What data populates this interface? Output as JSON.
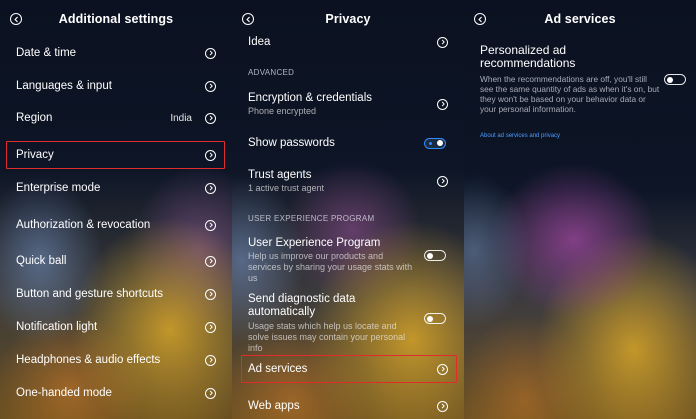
{
  "panel1": {
    "title": "Additional settings",
    "items": [
      {
        "label": "Date & time"
      },
      {
        "label": "Languages & input"
      },
      {
        "label": "Region",
        "value": "India"
      },
      {
        "label": "Privacy"
      },
      {
        "label": "Enterprise mode"
      },
      {
        "label": "Authorization & revocation"
      },
      {
        "label": "Quick ball"
      },
      {
        "label": "Button and gesture shortcuts"
      },
      {
        "label": "Notification light"
      },
      {
        "label": "Headphones & audio effects"
      },
      {
        "label": "One-handed mode"
      }
    ]
  },
  "panel2": {
    "title": "Privacy",
    "idea": "Idea",
    "section_advanced": "ADVANCED",
    "encryption": {
      "label": "Encryption & credentials",
      "sub": "Phone encrypted"
    },
    "show_passwords": {
      "label": "Show passwords",
      "enabled": true
    },
    "trust_agents": {
      "label": "Trust agents",
      "sub": "1 active trust agent"
    },
    "section_uep": "USER EXPERIENCE PROGRAM",
    "uep": {
      "label": "User Experience Program",
      "sub": "Help us improve our products and services by sharing your usage stats with us",
      "enabled": false
    },
    "diagnostic": {
      "label": "Send diagnostic data automatically",
      "sub": "Usage stats which help us locate and solve issues may contain your personal info",
      "enabled": false
    },
    "ad_services": "Ad services",
    "web_apps": "Web apps"
  },
  "panel3": {
    "title": "Ad services",
    "personalized_title": "Personalized ad recommendations",
    "personalized_desc": "When the recommendations are off, you'll still see the same quantity of ads as when it's on, but they won't be based on your behavior data or your personal information.",
    "personalized_enabled": false,
    "about_link": "About ad services and privacy"
  },
  "colors": {
    "highlight": "#e12c2c",
    "toggle_on": "#2f8bff",
    "link": "#4a9dff"
  }
}
